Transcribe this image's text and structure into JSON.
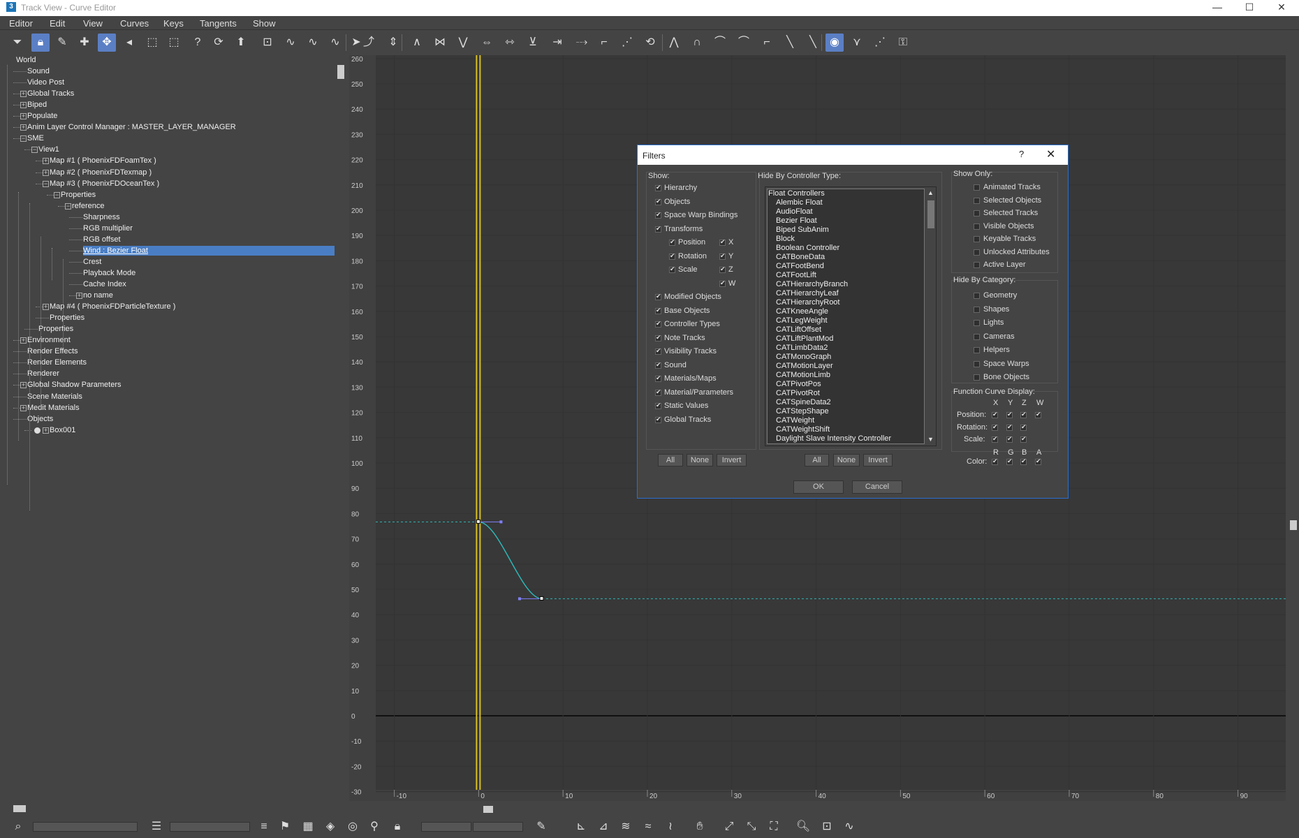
{
  "window": {
    "title": "Track View - Curve Editor",
    "app_icon": "3",
    "minimize": "—",
    "maximize": "☐",
    "close": "✕"
  },
  "menu": [
    "Editor",
    "Edit",
    "View",
    "Curves",
    "Keys",
    "Tangents",
    "Show"
  ],
  "toolbar_icons": [
    "filter-icon",
    "lock-icon",
    "edit-keys-icon",
    "add-keys-icon",
    "move-keys-icon",
    "slide-keys-icon",
    "scale-keys-icon",
    "scale-values-icon",
    "insert-time-icon",
    "loop-icon",
    "region-tool-icon",
    "set-keys-icon",
    "draw-curves-icon",
    "reduce-keys-icon",
    "isolate-icon",
    "select-icon",
    "parameter-curve-icon",
    "align-icon",
    "mirror-icon",
    "snap-icon",
    "zoom-horizontal-icon",
    "zoom-value-icon",
    "frame-icon",
    "zoom-region-icon",
    "flatten-icon",
    "break-tangents-icon",
    "unify-tangents-icon",
    "lock-tangents-icon",
    "show-tangents-icon",
    "tangent-auto-icon",
    "tangent-spline-icon",
    "tangent-fast-icon",
    "tangent-slow-icon",
    "tangent-step-icon",
    "tangent-linear-icon",
    "tangent-smooth-icon",
    "show-keyable-icon",
    "show-all-tangents-icon",
    "show-custom-icon",
    "lock-selection-icon"
  ],
  "tree": {
    "items": [
      {
        "label": "World",
        "depth": 0,
        "expander": ""
      },
      {
        "label": "Sound",
        "depth": 1,
        "expander": ""
      },
      {
        "label": "Video Post",
        "depth": 1,
        "expander": ""
      },
      {
        "label": "Global Tracks",
        "depth": 1,
        "expander": "+"
      },
      {
        "label": "Biped",
        "depth": 1,
        "expander": "+"
      },
      {
        "label": "Populate",
        "depth": 1,
        "expander": "+"
      },
      {
        "label": "Anim Layer Control Manager : MASTER_LAYER_MANAGER",
        "depth": 1,
        "expander": "+"
      },
      {
        "label": "SME",
        "depth": 1,
        "expander": "−"
      },
      {
        "label": "View1",
        "depth": 2,
        "expander": "−"
      },
      {
        "label": "Map #1  ( PhoenixFDFoamTex )",
        "depth": 3,
        "expander": "+"
      },
      {
        "label": "Map #2  ( PhoenixFDTexmap )",
        "depth": 3,
        "expander": "+"
      },
      {
        "label": "Map #3  ( PhoenixFDOceanTex )",
        "depth": 3,
        "expander": "−"
      },
      {
        "label": "Properties",
        "depth": 4,
        "expander": "−"
      },
      {
        "label": "reference",
        "depth": 5,
        "expander": "−"
      },
      {
        "label": "Sharpness",
        "depth": 6,
        "expander": ""
      },
      {
        "label": "RGB multiplier",
        "depth": 6,
        "expander": ""
      },
      {
        "label": "RGB offset",
        "depth": 6,
        "expander": ""
      },
      {
        "label": "Wind : Bezier Float",
        "depth": 6,
        "expander": "",
        "selected": true
      },
      {
        "label": "Crest",
        "depth": 6,
        "expander": ""
      },
      {
        "label": "Playback Mode",
        "depth": 6,
        "expander": ""
      },
      {
        "label": "Cache Index",
        "depth": 6,
        "expander": ""
      },
      {
        "label": "no name",
        "depth": 6,
        "expander": "+"
      },
      {
        "label": "Map #4  ( PhoenixFDParticleTexture )",
        "depth": 3,
        "expander": "+"
      },
      {
        "label": "Properties",
        "depth": 3,
        "expander": ""
      },
      {
        "label": "Properties",
        "depth": 2,
        "expander": ""
      },
      {
        "label": "Environment",
        "depth": 1,
        "expander": "+"
      },
      {
        "label": "Render Effects",
        "depth": 1,
        "expander": ""
      },
      {
        "label": "Render Elements",
        "depth": 1,
        "expander": ""
      },
      {
        "label": "Renderer",
        "depth": 1,
        "expander": ""
      },
      {
        "label": "Global Shadow Parameters",
        "depth": 1,
        "expander": "+"
      },
      {
        "label": "Scene Materials",
        "depth": 1,
        "expander": ""
      },
      {
        "label": "Medit Materials",
        "depth": 1,
        "expander": "+"
      },
      {
        "label": "Objects",
        "depth": 1,
        "expander": ""
      },
      {
        "label": "Box001",
        "depth": 2,
        "expander": "+",
        "bullet": true
      }
    ]
  },
  "graph": {
    "y_ticks": [
      260,
      250,
      240,
      230,
      220,
      210,
      200,
      190,
      180,
      170,
      160,
      150,
      140,
      130,
      120,
      110,
      100,
      90,
      80,
      70,
      60,
      50,
      40,
      30,
      20,
      10,
      0,
      -10,
      -20,
      -30
    ],
    "x_ticks": [
      -10,
      0,
      10,
      20,
      30,
      40,
      50,
      60,
      70,
      80,
      90
    ],
    "current_frame": 0,
    "keys": [
      {
        "frame": 0,
        "value": 76.7
      },
      {
        "frame": 7.5,
        "value": 46.3
      }
    ],
    "curve_color": "#2fb5b5",
    "time_slider_color": "#d8c020",
    "frame_bracket_color": "#ffd800"
  },
  "dialog": {
    "title": "Filters",
    "help": "?",
    "close": "✕",
    "show_label": "Show:",
    "show_items": [
      {
        "label": "Hierarchy",
        "checked": true
      },
      {
        "label": "Objects",
        "checked": true
      },
      {
        "label": "Space Warp Bindings",
        "checked": true
      },
      {
        "label": "Transforms",
        "checked": true
      }
    ],
    "transform_items": [
      {
        "label": "Position",
        "checked": true,
        "axis": "X"
      },
      {
        "label": "Rotation",
        "checked": true,
        "axis": "Y"
      },
      {
        "label": "Scale",
        "checked": true,
        "axis": "Z"
      },
      {
        "label": "",
        "checked": false,
        "axis": "W"
      }
    ],
    "show_items2": [
      {
        "label": "Modified Objects",
        "checked": true
      },
      {
        "label": "Base Objects",
        "checked": true
      },
      {
        "label": "Controller Types",
        "checked": true
      },
      {
        "label": "Note Tracks",
        "checked": true
      },
      {
        "label": "Visibility Tracks",
        "checked": true
      },
      {
        "label": "Sound",
        "checked": true
      },
      {
        "label": "Materials/Maps",
        "checked": true
      },
      {
        "label": "Material/Parameters",
        "checked": true
      },
      {
        "label": "Static Values",
        "checked": true
      },
      {
        "label": "Global Tracks",
        "checked": true
      }
    ],
    "hide_ctl_label": "Hide By Controller Type:",
    "controllers": [
      "Float Controllers",
      "Alembic Float",
      "AudioFloat",
      "Bezier Float",
      "Biped SubAnim",
      "Block",
      "Boolean Controller",
      "CATBoneData",
      "CATFootBend",
      "CATFootLift",
      "CATHierarchyBranch",
      "CATHierarchyLeaf",
      "CATHierarchyRoot",
      "CATKneeAngle",
      "CATLegWeight",
      "CATLiftOffset",
      "CATLiftPlantMod",
      "CATLimbData2",
      "CATMonoGraph",
      "CATMotionLayer",
      "CATMotionLimb",
      "CATPivotPos",
      "CATPivotRot",
      "CATSpineData2",
      "CATStepShape",
      "CATWeight",
      "CATWeightShift",
      "Daylight Slave Intensity Controller"
    ],
    "show_only_label": "Show Only:",
    "show_only": [
      "Animated Tracks",
      "Selected Objects",
      "Selected Tracks",
      "Visible Objects",
      "Keyable Tracks",
      "Unlocked Attributes",
      "Active Layer"
    ],
    "hide_cat_label": "Hide By Category:",
    "hide_cat": [
      "Geometry",
      "Shapes",
      "Lights",
      "Cameras",
      "Helpers",
      "Space Warps",
      "Bone Objects"
    ],
    "fcd_label": "Function Curve Display:",
    "fcd_cols": [
      "X",
      "Y",
      "Z",
      "W"
    ],
    "fcd_rows": [
      {
        "label": "Position:",
        "checks": [
          true,
          true,
          true,
          true
        ]
      },
      {
        "label": "Rotation:",
        "checks": [
          true,
          true,
          true
        ]
      },
      {
        "label": "Scale:",
        "checks": [
          true,
          true,
          true
        ]
      }
    ],
    "color_cols": [
      "R",
      "G",
      "B",
      "A"
    ],
    "color_label": "Color:",
    "btn_all": "All",
    "btn_none": "None",
    "btn_invert": "Invert",
    "ok": "OK",
    "cancel": "Cancel"
  }
}
